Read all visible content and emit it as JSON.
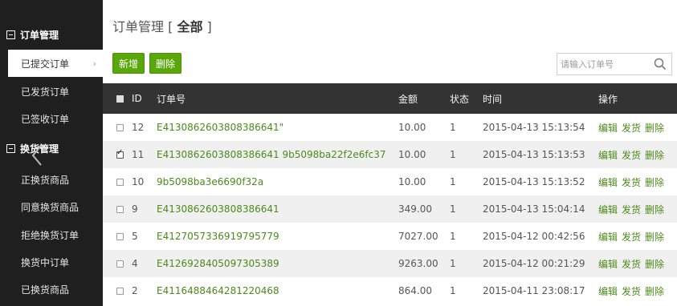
{
  "sidebar": {
    "groups": [
      {
        "title": "订单管理",
        "items": [
          {
            "label": "已提交订单",
            "active": true
          },
          {
            "label": "已发货订单"
          },
          {
            "label": "已签收订单"
          }
        ]
      },
      {
        "title": "换货管理",
        "items": [
          {
            "label": "正换货商品"
          },
          {
            "label": "同意换货商品"
          },
          {
            "label": "拒绝换货订单"
          },
          {
            "label": "换货中订单"
          },
          {
            "label": "已换货商品"
          }
        ]
      }
    ],
    "chevron": "›"
  },
  "header": {
    "title_prefix": "订单管理 [",
    "title_bold": "全部",
    "title_suffix": "]"
  },
  "toolbar": {
    "new_label": "新增",
    "delete_label": "删除",
    "search_placeholder": "请输入订单号"
  },
  "table": {
    "headers": {
      "id": "ID",
      "order_no": "订单号",
      "amount": "金额",
      "status": "状态",
      "time": "时间",
      "actions": "操作"
    },
    "action_labels": [
      "编辑",
      "发货",
      "删除"
    ],
    "rows": [
      {
        "id": "12",
        "order_no": "E4130862603808386641\"",
        "amount": "10.00",
        "status": "1",
        "time": "2015-04-13 15:13:54",
        "checked": false
      },
      {
        "id": "11",
        "order_no": "E4130862603808386641 9b5098ba22f2e6fc37",
        "amount": "10.00",
        "status": "1",
        "time": "2015-04-13 15:13:53",
        "checked": true
      },
      {
        "id": "10",
        "order_no": "9b5098ba3e6690f32a",
        "amount": "10.00",
        "status": "1",
        "time": "2015-04-13 15:13:52",
        "checked": false
      },
      {
        "id": "9",
        "order_no": "E4130862603808386641",
        "amount": "349.00",
        "status": "1",
        "time": "2015-04-13 15:04:14",
        "checked": false
      },
      {
        "id": "5",
        "order_no": "E4127057336919795779",
        "amount": "7027.00",
        "status": "1",
        "time": "2015-04-12 00:42:56",
        "checked": false
      },
      {
        "id": "4",
        "order_no": "E4126928405097305389",
        "amount": "9263.00",
        "status": "1",
        "time": "2015-04-12 00:21:29",
        "checked": false
      },
      {
        "id": "2",
        "order_no": "E4116488464281220468",
        "amount": "864.00",
        "status": "1",
        "time": "2015-04-11 23:08:17",
        "checked": false
      }
    ]
  },
  "colors": {
    "sidebar_bg": "#1f1f1f",
    "accent_green": "#5aa70b",
    "link_green": "#4c8a19",
    "table_header_bg": "#333333"
  },
  "icons": [
    "collapse-square-icon",
    "chevron-right-icon",
    "search-icon",
    "checkbox-icon",
    "left-arrow-icon"
  ]
}
